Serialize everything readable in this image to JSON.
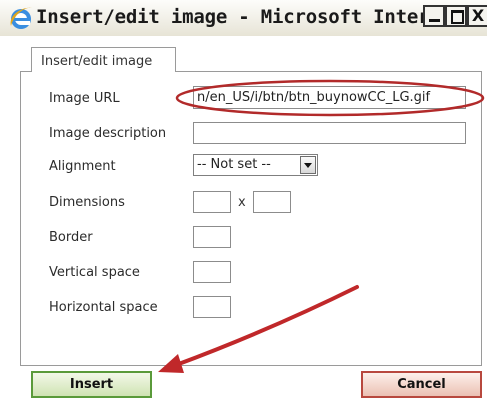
{
  "window": {
    "title": "Insert/edit image - Microsoft Interne...",
    "icon": "internet-explorer-icon",
    "controls": [
      "minimize-icon",
      "maximize-icon",
      "close-icon"
    ],
    "close_glyph": "X"
  },
  "tabs": [
    {
      "label": "Insert/edit image",
      "active": true
    }
  ],
  "form": {
    "image_url": {
      "label": "Image URL",
      "value": "n/en_US/i/btn/btn_buynowCC_LG.gif"
    },
    "image_description": {
      "label": "Image description",
      "value": ""
    },
    "alignment": {
      "label": "Alignment",
      "selected": "-- Not set --"
    },
    "dimensions": {
      "label": "Dimensions",
      "width": "",
      "height": "",
      "separator": "x"
    },
    "border": {
      "label": "Border",
      "value": ""
    },
    "vertical_space": {
      "label": "Vertical space",
      "value": ""
    },
    "horizontal_space": {
      "label": "Horizontal space",
      "value": ""
    }
  },
  "buttons": {
    "insert": "Insert",
    "cancel": "Cancel"
  },
  "annotations": {
    "highlight_color": "#b22a2a",
    "arrow_color": "#c0282a"
  }
}
